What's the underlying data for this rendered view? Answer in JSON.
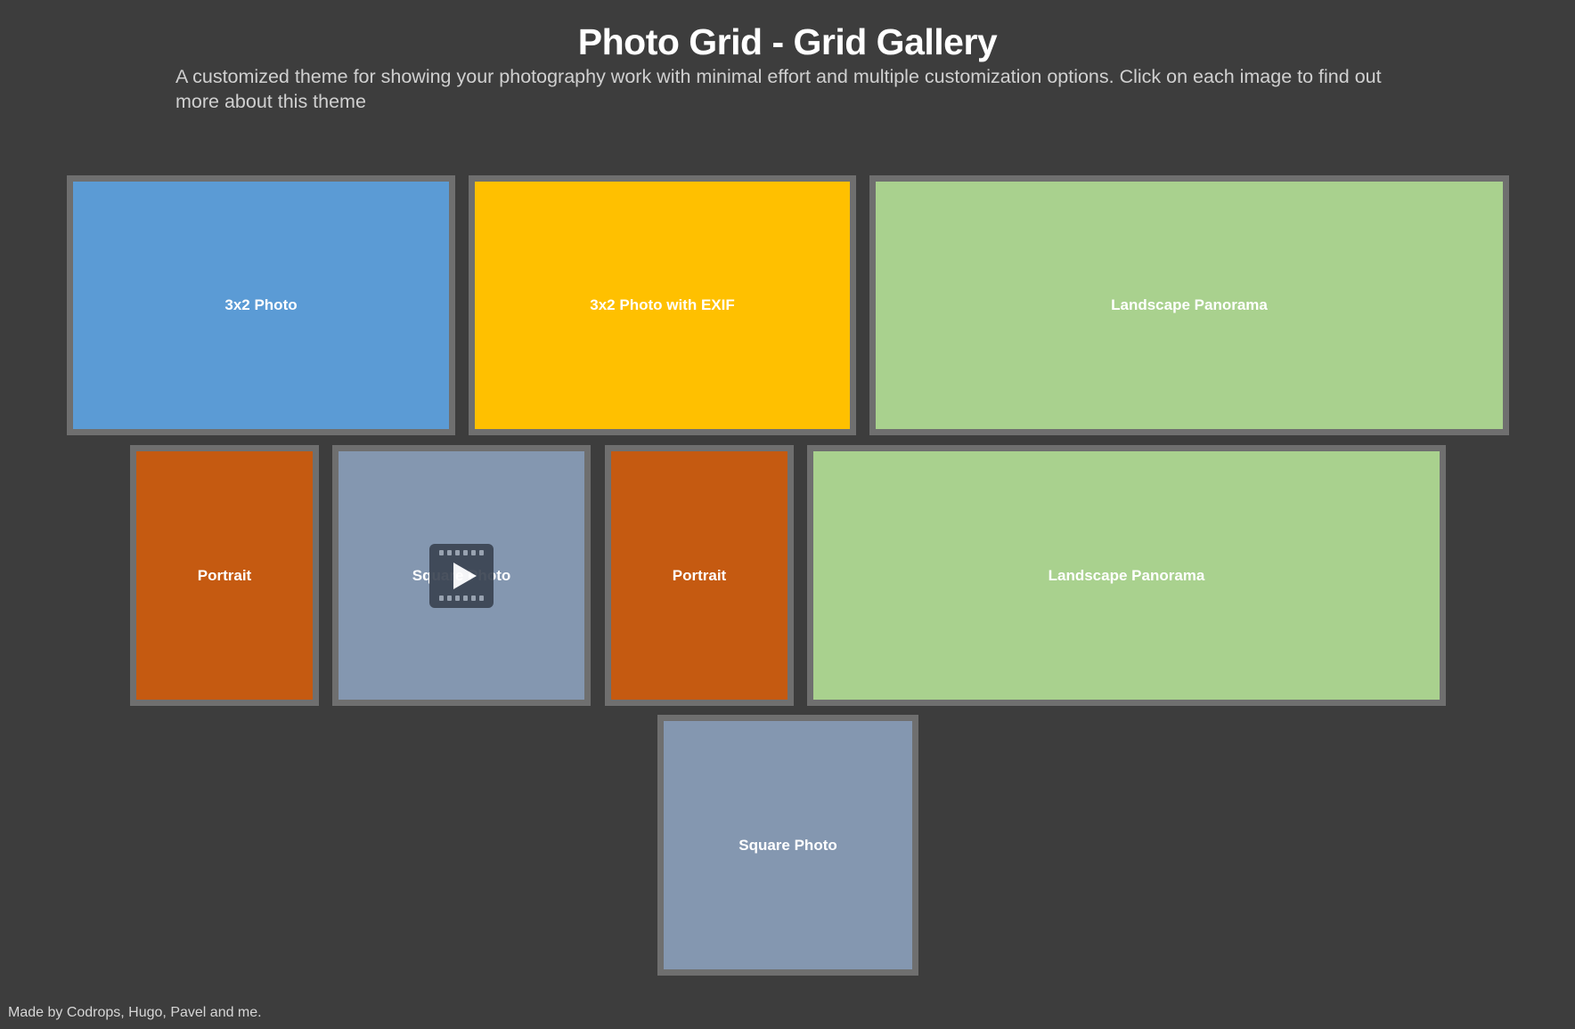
{
  "header": {
    "title": "Photo Grid - Grid Gallery",
    "subtitle": "A customized theme for showing your photography work with minimal effort and multiple customization options. Click on each image to find out more about this theme"
  },
  "gallery": {
    "tiles": [
      {
        "label": "3x2 Photo",
        "color": "#5b9bd5"
      },
      {
        "label": "3x2 Photo with EXIF",
        "color": "#ffc000"
      },
      {
        "label": "Landscape Panorama",
        "color": "#a9d18e"
      },
      {
        "label": "Portrait",
        "color": "#c55a11"
      },
      {
        "label": "Square Photo",
        "color": "#8497b0",
        "video": true,
        "icon": "film-play-icon"
      },
      {
        "label": "Portrait",
        "color": "#c55a11"
      },
      {
        "label": "Landscape Panorama",
        "color": "#a9d18e"
      },
      {
        "label": "Square Photo",
        "color": "#8497b0"
      }
    ]
  },
  "colors": {
    "background": "#3d3d3d",
    "tile_border": "#6f6f6f"
  },
  "footer": {
    "credit": "Made by Codrops, Hugo, Pavel and me."
  }
}
